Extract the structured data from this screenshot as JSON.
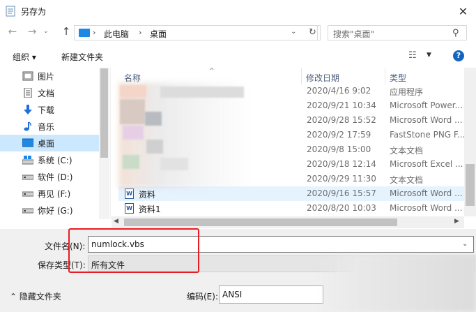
{
  "window": {
    "title": "另存为",
    "close": "✕"
  },
  "nav": {
    "back": "←",
    "forward": "→",
    "recent": "⌄",
    "up": "↑",
    "address": {
      "this_pc": "此电脑",
      "desktop": "桌面",
      "sep": "›",
      "dropdown": "⌄"
    },
    "refresh": "↻",
    "search_placeholder": "搜索\"桌面\"",
    "search_icon": "⚲"
  },
  "toolbar": {
    "organize": "组织 ▾",
    "new_folder": "新建文件夹",
    "view": "☷",
    "view_caret": "▼",
    "help": "?"
  },
  "sidebar": {
    "items": [
      {
        "label": "图片",
        "icon": "pictures-icon"
      },
      {
        "label": "文档",
        "icon": "documents-icon"
      },
      {
        "label": "下载",
        "icon": "download-icon"
      },
      {
        "label": "音乐",
        "icon": "music-icon"
      },
      {
        "label": "桌面",
        "icon": "desktop-icon",
        "selected": true
      },
      {
        "label": "系统 (C:)",
        "icon": "drive-icon"
      },
      {
        "label": "软件 (D:)",
        "icon": "drive-icon"
      },
      {
        "label": "再见 (F:)",
        "icon": "drive-icon"
      },
      {
        "label": "你好 (G:)",
        "icon": "drive-icon"
      }
    ]
  },
  "columns": {
    "name": "名称",
    "modified": "修改日期",
    "type": "类型",
    "sort_caret": "^"
  },
  "files": [
    {
      "name": "",
      "date": "2020/4/16 9:02",
      "type": "应用程序"
    },
    {
      "name": "",
      "date": "2020/9/21 10:34",
      "type": "Microsoft Power..."
    },
    {
      "name": "",
      "date": "2020/9/28 15:52",
      "type": "Microsoft Word ..."
    },
    {
      "name": "",
      "date": "2020/9/2 17:59",
      "type": "FastStone PNG F..."
    },
    {
      "name": "",
      "date": "2020/9/8 15:00",
      "type": "文本文档"
    },
    {
      "name": "",
      "date": "2020/9/18 12:14",
      "type": "Microsoft Excel ..."
    },
    {
      "name": "",
      "date": "2020/9/29 11:30",
      "type": "文本文档"
    },
    {
      "name": "资料",
      "date": "2020/9/16 15:57",
      "type": "Microsoft Word ...",
      "icon": "W"
    },
    {
      "name": "资料1",
      "date": "2020/8/20 10:03",
      "type": "Microsoft Word ...",
      "icon": "W"
    }
  ],
  "form": {
    "filename_label": "文件名(N):",
    "filename_value": "numlock.vbs",
    "filetype_label": "保存类型(T):",
    "filetype_value": "所有文件",
    "dropdown": "⌄"
  },
  "footer": {
    "hide_folders": "⌃  隐藏文件夹",
    "encoding_label": "编码(E):",
    "encoding_value": "ANSI"
  },
  "colors": {
    "accent": "#0078d7",
    "selected_bg": "#cce8ff",
    "highlight_red": "#e81c24"
  }
}
